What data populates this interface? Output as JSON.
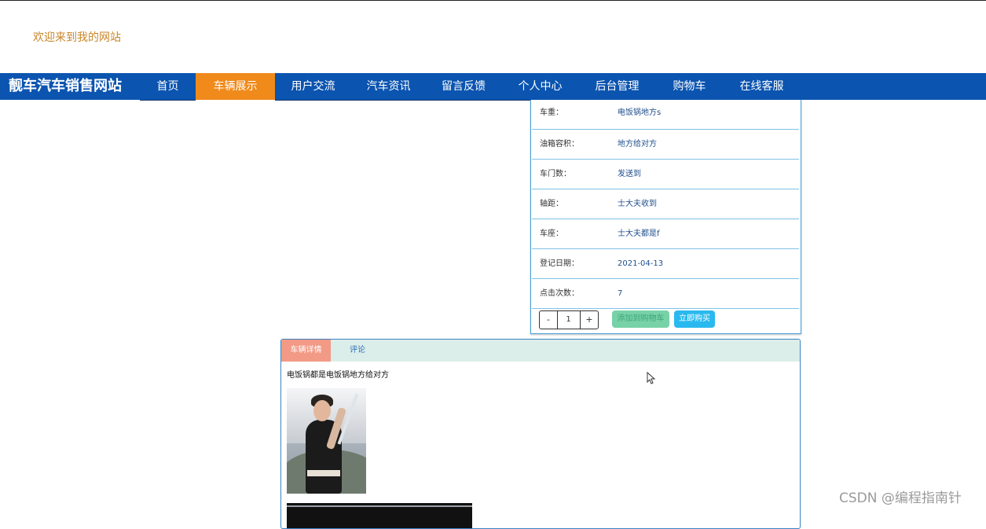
{
  "welcome_text": "欢迎来到我的网站",
  "brand": "靓车汽车销售网站",
  "nav": {
    "home": "首页",
    "vehicles": "车辆展示",
    "forum": "用户交流",
    "news": "汽车资讯",
    "feedback": "留言反馈",
    "profile": "个人中心",
    "admin": "后台管理",
    "cart": "购物车",
    "service": "在线客服"
  },
  "specs": [
    {
      "label": "车重：",
      "value": "电饭锅地方s"
    },
    {
      "label": "油箱容积：",
      "value": "地方给对方"
    },
    {
      "label": "车门数：",
      "value": "发送到"
    },
    {
      "label": "轴距：",
      "value": "士大夫收到"
    },
    {
      "label": "车座：",
      "value": "士大夫都是f"
    },
    {
      "label": "登记日期：",
      "value": "2021-04-13"
    },
    {
      "label": "点击次数：",
      "value": "7"
    }
  ],
  "actions": {
    "minus": "-",
    "quantity": "1",
    "plus": "+",
    "add_to_cart": "添加到购物车",
    "buy_now": "立即购买"
  },
  "detail": {
    "tab_details": "车辆详情",
    "tab_comments": "评论",
    "description": "电饭锅都是电饭锅地方给对方"
  },
  "watermark": "CSDN @编程指南针",
  "colors": {
    "nav_bg": "#0b54b0",
    "nav_active": "#f08a1a",
    "welcome": "#c8862a",
    "cart_button": "#78d2a8",
    "buy_button": "#2ab9ef",
    "tab_active": "#f29a86"
  }
}
